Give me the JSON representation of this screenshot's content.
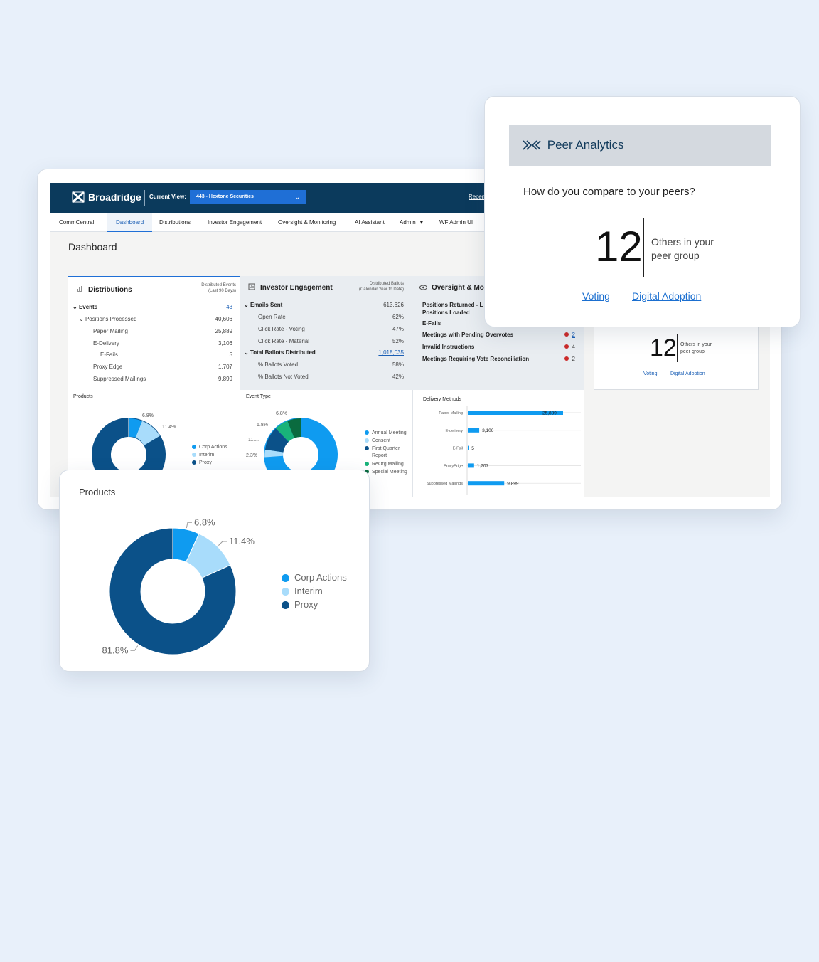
{
  "header": {
    "brand": "Broadridge",
    "current_view_label": "Current View:",
    "current_view_value": "443 - Hextone Securities",
    "recent_link": "Recen"
  },
  "nav": {
    "items": [
      "CommCentral",
      "Dashboard",
      "Distributions",
      "Investor Engagement",
      "Oversight & Monitoring",
      "AI Assistant",
      "Admin",
      "WF Admin UI"
    ],
    "active": "Dashboard",
    "admin_arrow": "▾"
  },
  "page_title": "Dashboard",
  "distributions": {
    "title": "Distributions",
    "subtitle_1": "Distributed Events",
    "subtitle_2": "(Last 90 Days)",
    "rows": [
      {
        "label": "Events",
        "value": "43"
      },
      {
        "label": "Positions Processed",
        "value": "40,606"
      },
      {
        "label": "Paper Mailing",
        "value": "25,889"
      },
      {
        "label": "E-Delivery",
        "value": "3,106"
      },
      {
        "label": "E-Fails",
        "value": "5"
      },
      {
        "label": "Proxy Edge",
        "value": "1,707"
      },
      {
        "label": "Suppressed Mailings",
        "value": "9,899"
      }
    ]
  },
  "investor_engagement": {
    "title": "Investor Engagement",
    "subtitle_1": "Distributed Ballots",
    "subtitle_2": "(Calendar Year to Date)",
    "rows": [
      {
        "label": "Emails Sent",
        "value": "613,626"
      },
      {
        "label": "Open Rate",
        "value": "62%"
      },
      {
        "label": "Click Rate - Voting",
        "value": "47%"
      },
      {
        "label": "Click Rate - Material",
        "value": "52%"
      },
      {
        "label": "Total Ballots Distributed",
        "value": "1,018,035"
      },
      {
        "label": "% Ballots Voted",
        "value": "58%"
      },
      {
        "label": "% Ballots Not Voted",
        "value": "42%"
      }
    ]
  },
  "oversight": {
    "title": "Oversight & Mo",
    "rows": [
      {
        "label": "Positions Returned - L",
        "value": ""
      },
      {
        "label": "Positions Loaded",
        "value": ""
      },
      {
        "label": "E-Fails",
        "value": ""
      },
      {
        "label": "Meetings with Pending Overvotes",
        "value": "2"
      },
      {
        "label": "Invalid Instructions",
        "value": "4"
      },
      {
        "label": "Meetings Requiring Vote Reconciliation",
        "value": "2"
      }
    ]
  },
  "mini_peer": {
    "number": "12",
    "others_1": "Others in your",
    "others_2": "peer group",
    "link_voting": "Voting",
    "link_digital": "Digital Adoption"
  },
  "charts_row": {
    "products_title": "Products",
    "event_type_title": "Event Type",
    "delivery_title": "Delivery Methods",
    "small_product_labels": [
      "6.8%",
      "11.4%"
    ],
    "event_labels": [
      "6.8%",
      "6.8%",
      "11....",
      "2.3%"
    ],
    "event_legend": [
      "Annual Meeting",
      "Consent",
      "First Quarter",
      "Report",
      "ReOrg Mailing",
      "Special Meeting"
    ]
  },
  "peer_analytics": {
    "title": "Peer Analytics",
    "question": "How do you compare to your peers?",
    "number": "12",
    "others_1": "Others in your",
    "others_2": "peer group",
    "link_voting": "Voting",
    "link_digital": "Digital Adoption"
  },
  "products_card": {
    "title": "Products"
  },
  "colors": {
    "corp_actions": "#0f9bf0",
    "interim": "#a8dcfb",
    "proxy": "#0b5189",
    "green": "#19b37a",
    "dark_green": "#0a6b3f",
    "bar": "#0f9bf0"
  },
  "chart_data": [
    {
      "type": "pie",
      "title": "Products",
      "categories": [
        "Corp Actions",
        "Interim",
        "Proxy"
      ],
      "values": [
        6.8,
        11.4,
        81.8
      ],
      "labels": [
        "6.8%",
        "11.4%",
        "81.8%"
      ],
      "legend": "right"
    },
    {
      "type": "pie",
      "title": "Event Type",
      "categories": [
        "Annual Meeting",
        "Consent",
        "First Quarter Report",
        "ReOrg Mailing",
        "Special Meeting"
      ],
      "values": [
        72.7,
        2.3,
        11.4,
        6.8,
        6.8
      ],
      "labels": [
        "",
        "2.3%",
        "11....",
        "6.8%",
        "6.8%"
      ],
      "legend": "right"
    },
    {
      "type": "bar",
      "orientation": "horizontal",
      "title": "Delivery Methods",
      "categories": [
        "Paper Mailing",
        "E-delivery",
        "E-Fail",
        "ProxyEdge",
        "Suppressed Mailings"
      ],
      "values": [
        25889,
        3106,
        5,
        1707,
        9899
      ],
      "value_labels": [
        "25,889",
        "3,106",
        "5",
        "1,707",
        "9,899"
      ]
    }
  ]
}
